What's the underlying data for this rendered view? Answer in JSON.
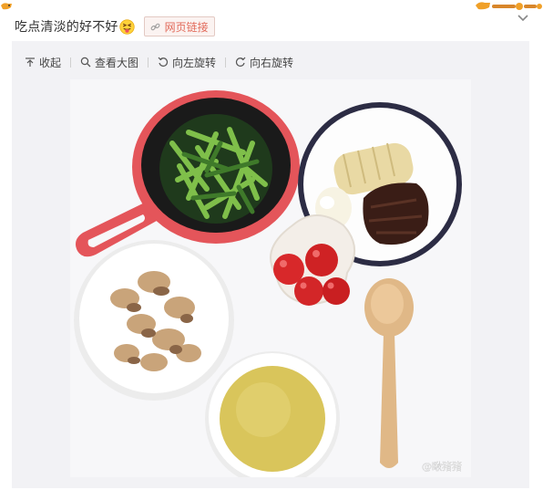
{
  "post": {
    "text": "吃点清淡的好不好",
    "emoji": "squinting-tongue-face-icon",
    "link_badge_label": "网页链接"
  },
  "toolbar": {
    "items": [
      {
        "label": "收起",
        "icon": "collapse-up-icon"
      },
      {
        "label": "查看大图",
        "icon": "search-icon"
      },
      {
        "label": "向左旋转",
        "icon": "rotate-left-icon"
      },
      {
        "label": "向右旋转",
        "icon": "rotate-right-icon"
      }
    ]
  },
  "photo": {
    "watermark": "@瞅猪猪"
  },
  "colors": {
    "link_badge_text": "#e26a5a",
    "skillet_red": "#e4555a",
    "media_background": "#f2f2f5"
  }
}
